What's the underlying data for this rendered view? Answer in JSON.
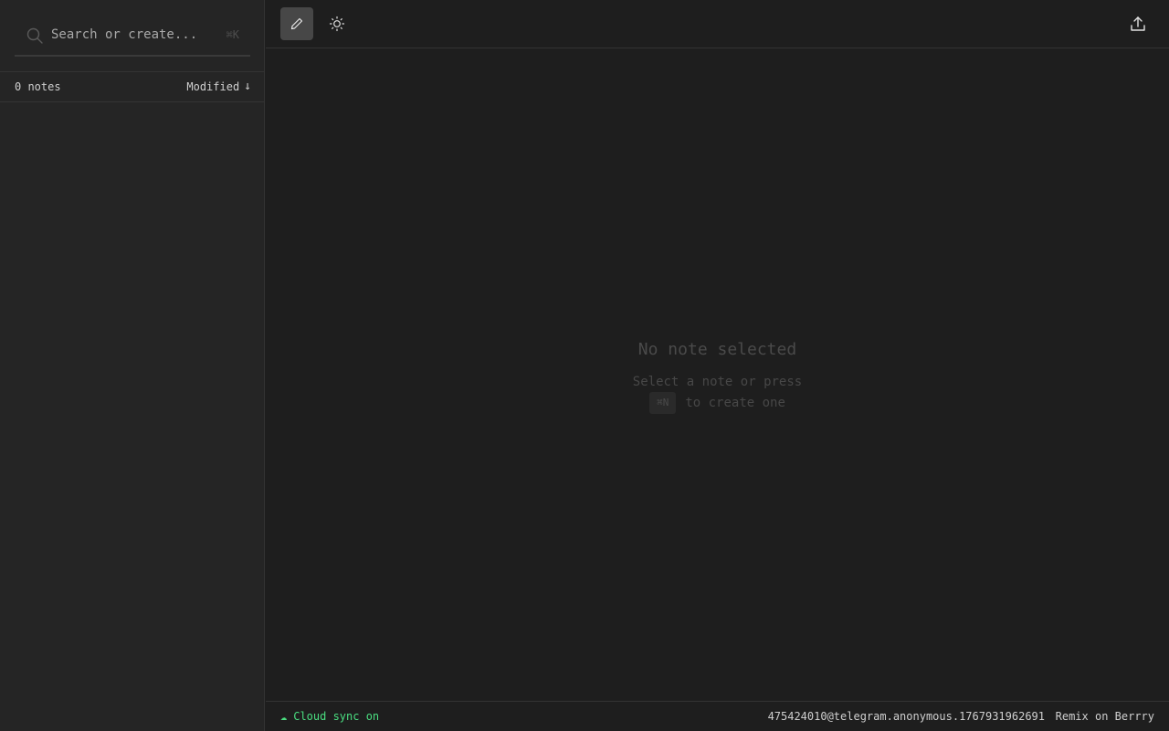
{
  "sidebar": {
    "search": {
      "placeholder": "Search or create...",
      "shortcut": "⌘K"
    },
    "notes_count": "0 notes",
    "sort": {
      "label": "Modified",
      "arrow": "↓"
    }
  },
  "toolbar": {
    "edit_icon": "pencil-icon",
    "theme_icon": "sun-icon",
    "export_icon": "upload-icon"
  },
  "empty_state": {
    "title": "No note selected",
    "line1": "Select a note or press",
    "shortcut": "⌘N",
    "line2": "to create one"
  },
  "statusbar": {
    "sync_icon": "☁",
    "sync_label": "Cloud sync on",
    "user_id": "475424010@telegram.anonymous.1767931962691",
    "remix_link": "Remix on Berrry"
  },
  "colors": {
    "background": "#1e1e1e",
    "sidebar": "#252525",
    "accent_green": "#4ade80",
    "active_button": "#474747"
  }
}
